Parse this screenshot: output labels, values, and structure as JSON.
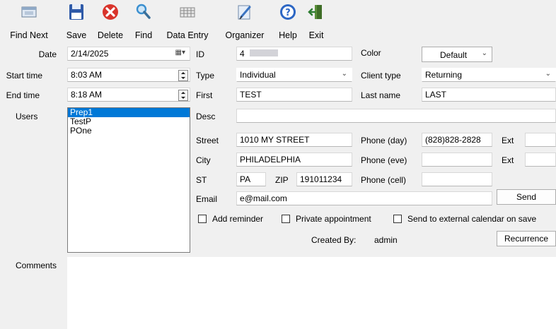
{
  "toolbar": {
    "find_next": "Find Next",
    "save": "Save",
    "delete": "Delete",
    "find": "Find",
    "data_entry": "Data Entry",
    "organizer": "Organizer",
    "help": "Help",
    "exit": "Exit"
  },
  "labels": {
    "date": "Date",
    "start_time": "Start time",
    "end_time": "End time",
    "users": "Users",
    "id": "ID",
    "type": "Type",
    "first": "First",
    "desc": "Desc",
    "street": "Street",
    "city": "City",
    "st": "ST",
    "zip": "ZIP",
    "email": "Email",
    "color": "Color",
    "client_type": "Client type",
    "last_name": "Last name",
    "phone_day": "Phone (day)",
    "phone_eve": "Phone (eve)",
    "phone_cell": "Phone (cell)",
    "ext1": "Ext",
    "ext2": "Ext",
    "created_by": "Created By:",
    "comments": "Comments"
  },
  "fields": {
    "date": "2/14/2025",
    "start_time": "8:03 AM",
    "end_time": "8:18 AM",
    "id": "4",
    "type": "Individual",
    "first": "TEST",
    "desc": "",
    "street": "1010 MY STREET",
    "city": "PHILADELPHIA",
    "st": "PA",
    "zip": "191011234",
    "email": "e@mail.com",
    "color": "Default",
    "client_type": "Returning",
    "last_name": "LAST",
    "phone_day": "(828)828-2828",
    "phone_eve": "",
    "phone_cell": "",
    "ext1": "",
    "ext2": "",
    "created_by": "admin",
    "comments": ""
  },
  "users": [
    "Prep1",
    "TestP",
    "POne"
  ],
  "checkboxes": {
    "add_reminder": "Add reminder",
    "private_appointment": "Private appointment",
    "send_external": "Send to external calendar on save"
  },
  "buttons": {
    "send": "Send",
    "recurrence": "Recurrence"
  },
  "colors": {
    "selection": "#0078d7",
    "delete_red": "#d9342b",
    "save_blue": "#2f5aa8"
  }
}
